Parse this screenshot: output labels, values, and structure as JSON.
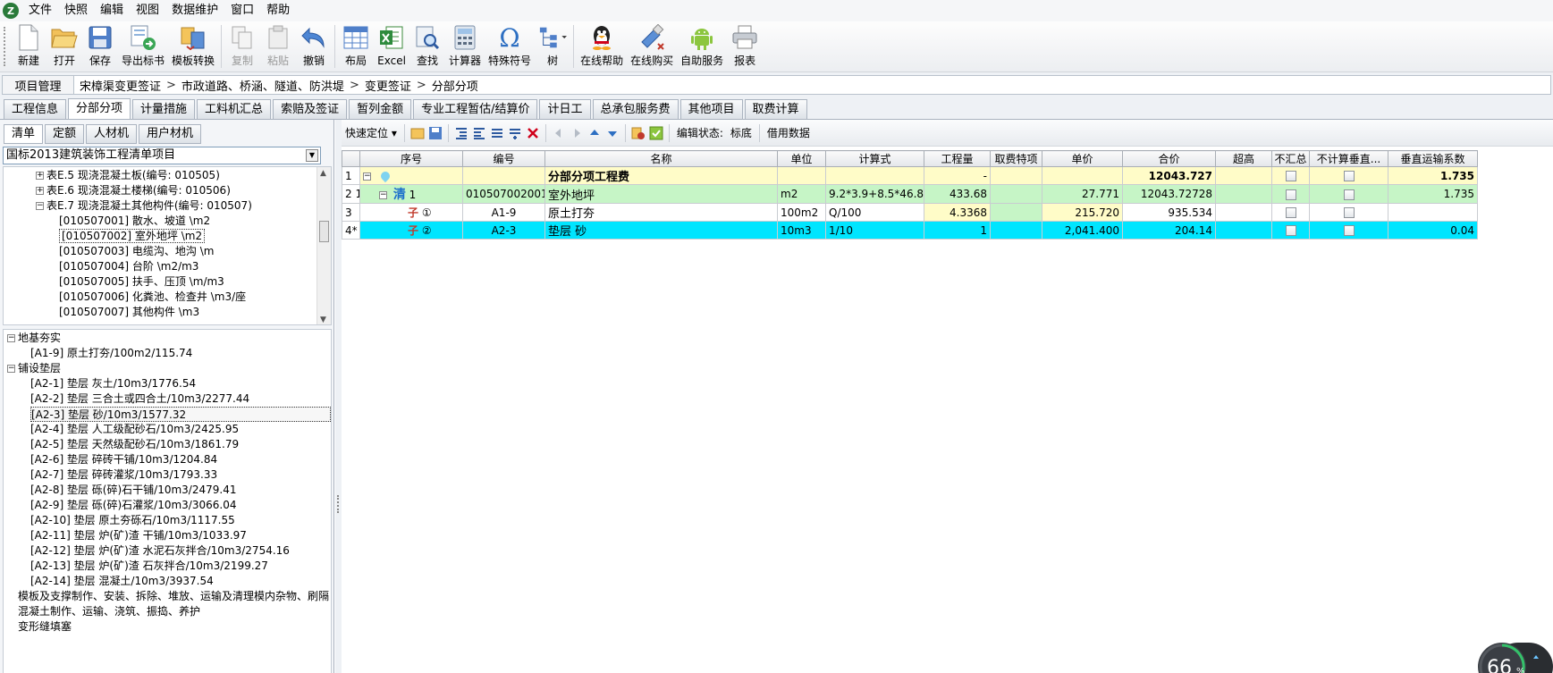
{
  "menu": {
    "items": [
      "文件",
      "快照",
      "编辑",
      "视图",
      "数据维护",
      "窗口",
      "帮助"
    ]
  },
  "toolbar": {
    "new": "新建",
    "open": "打开",
    "save": "保存",
    "export": "导出标书",
    "template": "模板转换",
    "copy": "复制",
    "paste": "粘贴",
    "undo": "撤销",
    "layout": "布局",
    "excel": "Excel",
    "find": "查找",
    "calculator": "计算器",
    "special": "特殊符号",
    "tree": "树",
    "online_help": "在线帮助",
    "online_buy": "在线购买",
    "self_service": "自助服务",
    "report": "报表"
  },
  "breadcrumb": {
    "project": "项目管理",
    "items": [
      "宋樟渠变更签证",
      "市政道路、桥涵、隧道、防洪堤",
      "变更签证",
      "分部分项"
    ]
  },
  "tabs": [
    "工程信息",
    "分部分项",
    "计量措施",
    "工料机汇总",
    "索赔及签证",
    "暂列金额",
    "专业工程暂估/结算价",
    "计日工",
    "总承包服务费",
    "其他项目",
    "取费计算"
  ],
  "left": {
    "subtabs": [
      "清单",
      "定额",
      "人材机",
      "用户材机"
    ],
    "combo_value": "国标2013建筑装饰工程清单项目",
    "tree1": [
      {
        "text": "表E.5 现浇混凝土板(编号: 010505)",
        "level": 1,
        "toggle": "+"
      },
      {
        "text": "表E.6 现浇混凝土楼梯(编号: 010506)",
        "level": 1,
        "toggle": "+"
      },
      {
        "text": "表E.7 现浇混凝土其他构件(编号: 010507)",
        "level": 1,
        "toggle": "-"
      },
      {
        "text": "[010507001] 散水、坡道 \\m2",
        "level": 2
      },
      {
        "text": "[010507002] 室外地坪 \\m2",
        "level": 2,
        "selected": true
      },
      {
        "text": "[010507003] 电缆沟、地沟 \\m",
        "level": 2
      },
      {
        "text": "[010507004] 台阶 \\m2/m3",
        "level": 2
      },
      {
        "text": "[010507005] 扶手、压顶 \\m/m3",
        "level": 2
      },
      {
        "text": "[010507006] 化粪池、检查井 \\m3/座",
        "level": 2
      },
      {
        "text": "[010507007] 其他构件 \\m3",
        "level": 2
      }
    ],
    "tree2": [
      {
        "text": "地基夯实",
        "level": 0,
        "toggle": "-"
      },
      {
        "text": "[A1-9] 原土打夯/100m2/115.74",
        "level": 1
      },
      {
        "text": "铺设垫层",
        "level": 0,
        "toggle": "-"
      },
      {
        "text": "[A2-1] 垫层 灰土/10m3/1776.54",
        "level": 1
      },
      {
        "text": "[A2-2] 垫层 三合土或四合土/10m3/2277.44",
        "level": 1
      },
      {
        "text": "[A2-3] 垫层 砂/10m3/1577.32",
        "level": 1,
        "selected": true
      },
      {
        "text": "[A2-4] 垫层 人工级配砂石/10m3/2425.95",
        "level": 1
      },
      {
        "text": "[A2-5] 垫层 天然级配砂石/10m3/1861.79",
        "level": 1
      },
      {
        "text": "[A2-6] 垫层 碎砖干铺/10m3/1204.84",
        "level": 1
      },
      {
        "text": "[A2-7] 垫层 碎砖灌浆/10m3/1793.33",
        "level": 1
      },
      {
        "text": "[A2-8] 垫层 砾(碎)石干铺/10m3/2479.41",
        "level": 1
      },
      {
        "text": "[A2-9] 垫层 砾(碎)石灌浆/10m3/3066.04",
        "level": 1
      },
      {
        "text": "[A2-10] 垫层 原土夯砾石/10m3/1117.55",
        "level": 1
      },
      {
        "text": "[A2-11] 垫层 炉(矿)渣 干铺/10m3/1033.97",
        "level": 1
      },
      {
        "text": "[A2-12] 垫层 炉(矿)渣 水泥石灰拌合/10m3/2754.16",
        "level": 1
      },
      {
        "text": "[A2-13] 垫层 炉(矿)渣 石灰拌合/10m3/2199.27",
        "level": 1
      },
      {
        "text": "[A2-14] 垫层 混凝土/10m3/3937.54",
        "level": 1
      },
      {
        "text": "模板及支撑制作、安装、拆除、堆放、运输及清理模内杂物、刷隔",
        "level": 0
      },
      {
        "text": "混凝土制作、运输、浇筑、振捣、养护",
        "level": 0
      },
      {
        "text": "变形缝填塞",
        "level": 0
      }
    ]
  },
  "right_toolbar": {
    "quick_locate": "快速定位",
    "edit_state_label": "编辑状态:",
    "edit_state_value": "标底",
    "borrow": "借用数据"
  },
  "grid": {
    "headers": [
      "",
      "序号",
      "编号",
      "名称",
      "单位",
      "计算式",
      "工程量",
      "取费特项",
      "单价",
      "合价",
      "超高",
      "不汇总",
      "不计算垂直...",
      "垂直运输系数"
    ],
    "rows": [
      {
        "rn": "1",
        "seq": "",
        "code": "",
        "name": "分部分项工程费",
        "unit": "",
        "formula": "",
        "qty": "-",
        "fee": "",
        "price": "",
        "total": "12043.727",
        "coef": "1.735"
      },
      {
        "rn": "2 1",
        "seq": "1",
        "code": "010507002001",
        "name": "室外地坪",
        "unit": "m2",
        "formula": "9.2*3.9+8.5*46.8",
        "qty": "433.68",
        "fee": "",
        "price": "27.771",
        "total": "12043.72728",
        "coef": "1.735",
        "badge": "清"
      },
      {
        "rn": "3",
        "seq": "①",
        "code": "A1-9",
        "name": "原土打夯",
        "unit": "100m2",
        "formula": "Q/100",
        "qty": "4.3368",
        "fee": "",
        "price": "215.720",
        "total": "935.534",
        "coef": "",
        "badge": "子"
      },
      {
        "rn": "4*",
        "seq": "②",
        "code": "A2-3",
        "name": "垫层 砂",
        "unit": "10m3",
        "formula": "1/10",
        "qty": "1",
        "fee": "",
        "price": "2,041.400",
        "total": "204.14",
        "coef": "0.04",
        "badge": "子"
      }
    ]
  },
  "gauge": {
    "value": "66",
    "unit": "%"
  },
  "colors": {
    "summary_row": "#fffcc8",
    "list_row": "#c6f5c6",
    "selected_row": "#00e5ff",
    "accent": "#1c6fcc"
  }
}
